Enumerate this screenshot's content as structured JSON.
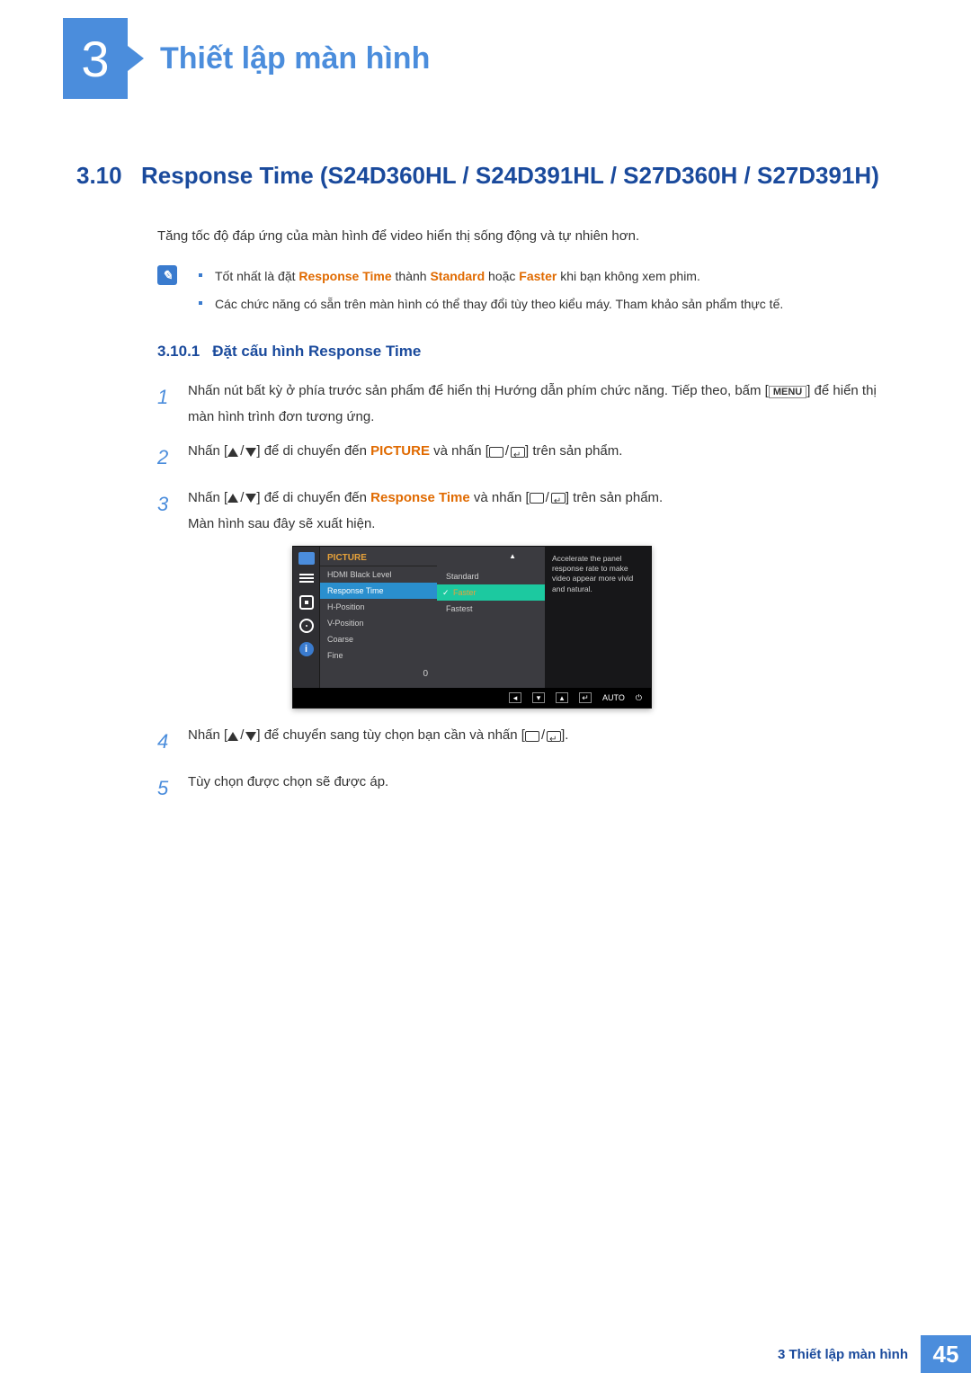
{
  "chapter": {
    "number": "3",
    "title": "Thiết lập màn hình"
  },
  "section": {
    "number": "3.10",
    "title": "Response Time (S24D360HL / S24D391HL / S27D360H / S27D391H)"
  },
  "intro": "Tăng tốc độ đáp ứng của màn hình để video hiển thị sống động và tự nhiên hơn.",
  "notes": {
    "item1_pre": "Tốt nhất là đặt ",
    "item1_rt": "Response Time",
    "item1_mid": " thành ",
    "item1_std": "Standard",
    "item1_or": " hoặc ",
    "item1_fast": "Faster",
    "item1_post": " khi bạn không xem phim.",
    "item2": "Các chức năng có sẵn trên màn hình có thể thay đổi tùy theo kiểu máy. Tham khảo sản phẩm thực tế."
  },
  "subsection": {
    "number": "3.10.1",
    "title": "Đặt cấu hình Response Time"
  },
  "steps": {
    "s1_a": "Nhấn nút bất kỳ ở phía trước sản phẩm để hiển thị Hướng dẫn phím chức năng. Tiếp theo, bấm [",
    "s1_menu": "MENU",
    "s1_b": "] để hiển thị màn hình trình đơn tương ứng.",
    "s2_a": "Nhấn [",
    "s2_b": "] để di chuyển đến ",
    "s2_pic": "PICTURE",
    "s2_c": " và nhấn [",
    "s2_d": "] trên sản phẩm.",
    "s3_a": "Nhấn [",
    "s3_b": "] để di chuyển đến ",
    "s3_rt": "Response Time",
    "s3_c": " và nhấn [",
    "s3_d": "] trên sản phẩm.",
    "s3_e": "Màn hình sau đây sẽ xuất hiện.",
    "s4_a": "Nhấn [",
    "s4_b": "] để chuyển sang tùy chọn bạn cần và nhấn [",
    "s4_c": "].",
    "s5": "Tùy chọn được chọn sẽ được áp."
  },
  "osd": {
    "menu_title": "PICTURE",
    "items": [
      "HDMI Black Level",
      "Response Time",
      "H-Position",
      "V-Position",
      "Coarse",
      "Fine"
    ],
    "active_index": 1,
    "options": [
      "Standard",
      "Faster",
      "Fastest"
    ],
    "selected_option_index": 1,
    "description": "Accelerate the panel response rate to make video appear more vivid and natural.",
    "value": "0",
    "footer_auto": "AUTO",
    "info_i": "i"
  },
  "footer": {
    "title": "3 Thiết lập màn hình",
    "page": "45"
  }
}
